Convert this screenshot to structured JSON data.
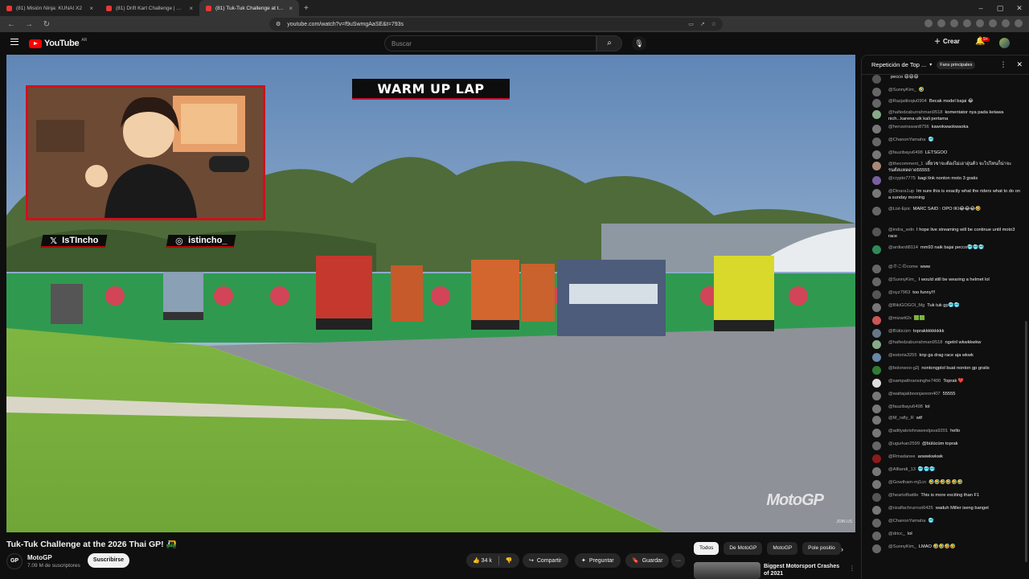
{
  "browser": {
    "tabs": [
      {
        "title": "(81) Misión Ninja: KUNAI X2",
        "active": false
      },
      {
        "title": "(81) Drift Kart Challenge | How precise",
        "active": false
      },
      {
        "title": "(81) Tuk-Tuk Challenge at the 2026",
        "active": true
      }
    ],
    "url": "youtube.com/watch?v=f9uSwmgAaSE&t=793s",
    "window_controls": [
      "–",
      "▢",
      "✕"
    ],
    "back_icon": "←",
    "forward_icon": "→",
    "reload_icon": "↻"
  },
  "masthead": {
    "logo_text": "YouTube",
    "country_code": "AR",
    "search_placeholder": "Buscar",
    "create_label": "Crear",
    "notifications_badge": "9+"
  },
  "video": {
    "overlay_banner": "WARM UP LAP",
    "social_twitter": "IsTIncho",
    "social_instagram": "istincho_",
    "watermark": "MotoGP",
    "join_text": "JOIN US"
  },
  "below": {
    "title": "Tuk-Tuk Challenge at the 2026 Thai GP! 🛺",
    "channel_name": "MotoGP",
    "channel_avatar_text": "GP",
    "subscribers": "7.09 M de suscriptores",
    "subscribe_label": "Suscribirse",
    "like_count": "34 k",
    "share_label": "Compartir",
    "ask_label": "Preguntar",
    "save_label": "Guardar",
    "more_label": "···"
  },
  "recommendations": {
    "chips": [
      "Todos",
      "De MotoGP",
      "MotoGP",
      "Pole positio"
    ],
    "selected_chip": "Todos",
    "next_icon": "›",
    "first_title": "Biggest Motorsport Crashes of 2021"
  },
  "chat": {
    "title": "Repetición de Top ...",
    "fans_pill": "Fans principales",
    "messages": [
      {
        "author": "",
        "text": "pecco 😄😄😄",
        "color": "#555"
      },
      {
        "author": "@SunnyKim_",
        "text": "🤣",
        "color": "#666"
      },
      {
        "author": "@Razjatiloqiu0904",
        "text": "Becak model bajai 😂",
        "color": "#666"
      },
      {
        "author": "@hafiedzaburrahman9518",
        "text": "komentator nya pada ketawa nich...karena utk kali pertama",
        "color": "#8a8"
      },
      {
        "author": "@heruwirawan8756",
        "text": "kawokwaokwaoka",
        "color": "#777"
      },
      {
        "author": "@ChanonYamaha",
        "text": "🥶",
        "color": "#666"
      },
      {
        "author": "@fauzibayu6498",
        "text": "LETSGOO",
        "color": "#777"
      },
      {
        "author": "@thecomment_1",
        "text": "เดี๋ยวขาจะต้องไม่เอาอุ่นต้ว จะไปไหนก็น่าจะ รนต์สแทดดาด55555",
        "color": "#a87"
      },
      {
        "author": "@crypto7775",
        "text": "bagi link nonton moto 3 gratis",
        "color": "#7a5fa0"
      },
      {
        "author": "@Dinara1up",
        "text": "Im sure this is exactly what the riders what to do on a sunday morning",
        "color": "#777"
      },
      {
        "author": "@List-Epic",
        "text": "MARC SAID : OPO IKI😂😂😂🤣",
        "color": "#666"
      },
      {
        "author": "@indra_wdn",
        "text": "I hope live streaming will be continue until moto3 race",
        "color": "#555"
      },
      {
        "author": "@ardiardi8114",
        "text": "mm93 naik bajai pecco🥶🥶🥶",
        "color": "#2e8b57"
      },
      {
        "author": "@ホこのcome",
        "text": "www",
        "color": "#666"
      },
      {
        "author": "@SunnyKim_",
        "text": "I would still be wearing a helmet lol",
        "color": "#666"
      },
      {
        "author": "@oyz7963",
        "text": "too funny!!!",
        "color": "#555"
      },
      {
        "author": "@BikiGOGOI_Mg",
        "text": "Tuk tuk gp🥶🥶",
        "color": "#777"
      },
      {
        "author": "@mizartt2x",
        "text": "🟩🟩",
        "color": "#c55"
      },
      {
        "author": "@Bülücüm",
        "text": "toprakkkkkkkkk",
        "color": "#678"
      },
      {
        "author": "@hafiedzaburrahman9518",
        "text": "ngetril wkwkkwkw",
        "color": "#8a8"
      },
      {
        "author": "@estoria3255",
        "text": "knp ga drag race aja wkwk",
        "color": "#68a"
      },
      {
        "author": "@bolorwoo-g2j",
        "text": "nontongplol buat nonton gp gratis",
        "color": "#2e7d32"
      },
      {
        "author": "@sampathransinghe7400",
        "text": "Toprak ❤️",
        "color": "#ddd"
      },
      {
        "author": "@wattajakboonjareon407",
        "text": "55555",
        "color": "#777"
      },
      {
        "author": "@fauzibayu6498",
        "text": "lol",
        "color": "#777"
      },
      {
        "author": "@M_rafly_R",
        "text": "wtf",
        "color": "#777"
      },
      {
        "author": "@adityakrishnawestjava9201",
        "text": "hello",
        "color": "#777"
      },
      {
        "author": "@ugurkan2599",
        "text": "@bülücüm toprak",
        "color": "#666"
      },
      {
        "author": "@Rmadanee",
        "text": "aowwkwkwk",
        "color": "#8b1a1a"
      },
      {
        "author": "@Alfiandi_13",
        "text": "🥶🥶🥶",
        "color": "#777"
      },
      {
        "author": "@Gowtham-mj1cn",
        "text": "🤣🤣🤣🤣🤣🤣",
        "color": "#777"
      },
      {
        "author": "@heartofbattle",
        "text": "This is more exciting than F1",
        "color": "#555"
      },
      {
        "author": "@rizalfachrurrozi6425",
        "text": "waduh Miller iseng banget",
        "color": "#777"
      },
      {
        "author": "@ChanonYamaha",
        "text": "🥶",
        "color": "#666"
      },
      {
        "author": "@dricc_",
        "text": "lol",
        "color": "#666"
      },
      {
        "author": "@SunnyKim_",
        "text": "LMAO 🤣🤣🤣🤣",
        "color": "#666"
      }
    ]
  },
  "colors": {
    "youtube_red": "#ff0000",
    "overlay_red": "#d0101c",
    "background": "#0f0f0f"
  }
}
